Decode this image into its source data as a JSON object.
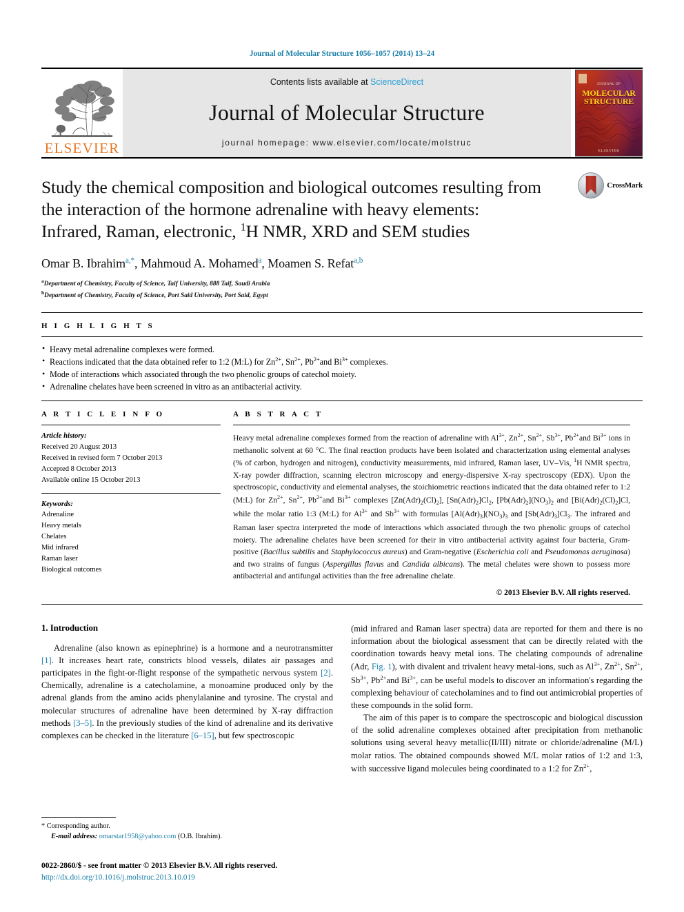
{
  "running_head": "Journal of Molecular Structure 1056–1057 (2014) 13–24",
  "masthead": {
    "contents_prefix": "Contents lists available at ",
    "sciencedirect": "ScienceDirect",
    "journal_title": "Journal of Molecular Structure",
    "homepage": "journal homepage: www.elsevier.com/locate/molstruc",
    "publisher_logo_text": "ELSEVIER",
    "cover": {
      "small_top": "JOURNAL OF",
      "line1": "MOLECULAR",
      "line2": "STRUCTURE",
      "bottom": "ELSEVIER"
    }
  },
  "article": {
    "title_line1": "Study the chemical composition and biological outcomes resulting from",
    "title_line2": "the interaction of the hormone adrenaline with heavy elements:",
    "title_line3_a": "Infrared, Raman, electronic, ",
    "title_line3_sup": "1",
    "title_line3_b": "H NMR, XRD and SEM studies",
    "crossmark_label": "CrossMark",
    "authors_html": "Omar B. Ibrahim, Mahmoud A. Mohamed, Moamen S. Refat",
    "author_1": "Omar B. Ibrahim",
    "author_1_sup": "a,*",
    "author_2": "Mahmoud A. Mohamed",
    "author_2_sup": "a",
    "author_3": "Moamen S. Refat",
    "author_3_sup": "a,b",
    "affiliation_a_sup": "a",
    "affiliation_a": "Department of Chemistry, Faculty of Science, Taif University, 888 Taif, Saudi Arabia",
    "affiliation_b_sup": "b",
    "affiliation_b": "Department of Chemistry, Faculty of Science, Port Said University, Port Said, Egypt"
  },
  "highlights": {
    "heading": "H I G H L I G H T S",
    "items": [
      "Heavy metal adrenaline complexes were formed.",
      "Reactions indicated that the data obtained refer to 1:2 (M:L) for Zn2+, Sn2+, Pb2+and Bi3+ complexes.",
      "Mode of interactions which associated through the two phenolic groups of catechol moiety.",
      "Adrenaline chelates have been screened in vitro as an antibacterial activity."
    ]
  },
  "article_info": {
    "heading": "A R T I C L E    I N F O",
    "history_label": "Article history:",
    "history": [
      "Received 20 August 2013",
      "Received in revised form 7 October 2013",
      "Accepted 8 October 2013",
      "Available online 15 October 2013"
    ],
    "keywords_label": "Keywords:",
    "keywords": [
      "Adrenaline",
      "Heavy metals",
      "Chelates",
      "Mid infrared",
      "Raman laser",
      "Biological outcomes"
    ]
  },
  "abstract": {
    "heading": "A B S T R A C T",
    "copyright": "© 2013 Elsevier B.V. All rights reserved."
  },
  "introduction": {
    "heading": "1. Introduction",
    "left_para_1_plain": "Adrenaline (also known as epinephrine) is a hormone and a neurotransmitter [1]. It increases heart rate, constricts blood vessels, dilates air passages and participates in the fight-or-flight response of the sympathetic nervous system [2]. Chemically, adrenaline is a catecholamine, a monoamine produced only by the adrenal glands from the amino acids phenylalanine and tyrosine. The crystal and molecular structures of adrenaline have been determined by X-ray diffraction methods [3–5]. In the previously studies of the kind of adrenaline and its derivative complexes can be checked in the literature [6–15], but few spectroscopic",
    "right_para_1_plain": "(mid infrared and Raman laser spectra) data are reported for them and there is no information about the biological assessment that can be directly related with the coordination towards heavy metal ions. The chelating compounds of adrenaline (Adr, Fig. 1), with divalent and trivalent heavy metal-ions, such as Al3+, Zn2+, Sn2+, Sb3+, Pb2+and Bi3+, can be useful models to discover an information's regarding the complexing behaviour of catecholamines and to find out antimicrobial properties of these compounds in the solid form.",
    "right_para_2_plain": "The aim of this paper is to compare the spectroscopic and biological discussion of the solid adrenaline complexes obtained after precipitation from methanolic solutions using several heavy metallic(II/III) nitrate or chloride/adrenaline (M/L) molar ratios. The obtained compounds showed M/L molar ratios of 1:2 and 1:3, with successive ligand molecules being coordinated to a 1:2 for Zn2+,"
  },
  "footnote": {
    "corresponding": "* Corresponding author.",
    "email_label": "E-mail address:",
    "email": "omarstar1958@yahoo.com",
    "email_owner": "(O.B. Ibrahim)."
  },
  "footer": {
    "issn_line": "0022-2860/$ - see front matter © 2013 Elsevier B.V. All rights reserved.",
    "doi": "http://dx.doi.org/10.1016/j.molstruc.2013.10.019"
  },
  "colors": {
    "link": "#1b7fa8",
    "elsevier_orange": "#E87722",
    "sciencedirect": "#2a9fd6"
  }
}
